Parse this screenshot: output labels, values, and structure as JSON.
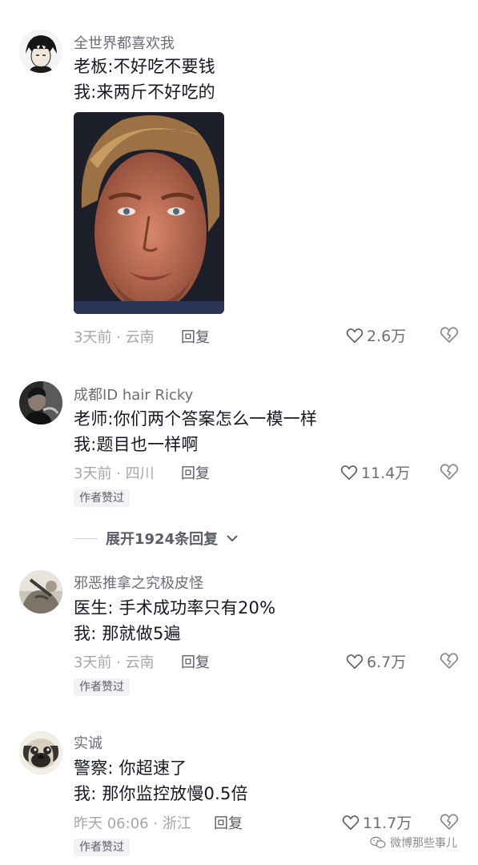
{
  "comments": [
    {
      "username": "全世界都喜欢我",
      "lines": [
        "老板:不好吃不要钱",
        "我:来两斤不好吃的"
      ],
      "time": "3天前 · 云南",
      "reply": "回复",
      "likes": "2.6万"
    },
    {
      "username": "成都ID hair Ricky",
      "lines": [
        "老师:你们两个答案怎么一模一样",
        "我:题目也一样啊"
      ],
      "time": "3天前 · 四川",
      "reply": "回复",
      "likes": "11.4万",
      "badge": "作者赞过"
    },
    {
      "username": "邪恶推拿之究极皮怪",
      "lines": [
        "医生: 手术成功率只有20%",
        "我:  那就做5遍"
      ],
      "time": "3天前 · 云南",
      "reply": "回复",
      "likes": "6.7万",
      "badge": "作者赞过"
    },
    {
      "username": "实诚",
      "lines": [
        "警察:  你超速了",
        "我:  那你监控放慢0.5倍"
      ],
      "time": "昨天 06:06 · 浙江",
      "reply": "回复",
      "likes": "11.7万",
      "badge": "作者赞过"
    }
  ],
  "expand_label": "展开1924条回复",
  "watermark": "微博那些事儿",
  "colors": {
    "text": "#161823",
    "secondary": "#6b6e76",
    "meta": "#a5a7ac",
    "badge_bg": "#f2f2f4"
  },
  "icons": [
    "heart-outline-icon",
    "broken-heart-icon",
    "chevron-down-icon",
    "wechat-logo-icon"
  ]
}
